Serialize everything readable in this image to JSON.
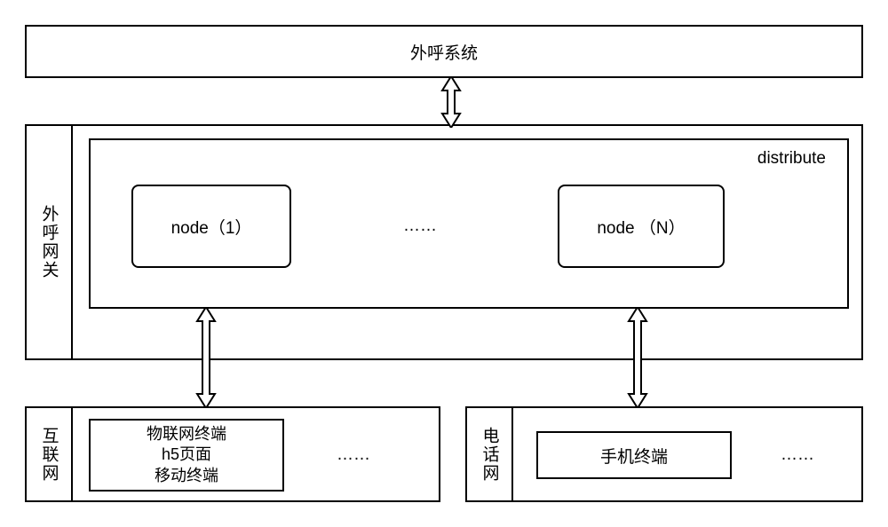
{
  "top": {
    "label": "外呼系统"
  },
  "gateway": {
    "side_label": "外呼网关",
    "distribute_label": "distribute",
    "node_left": "node（1）",
    "node_right": "node （N）",
    "ellipsis": "……"
  },
  "internet": {
    "side_label": "互联网",
    "terminal_line1": "物联网终端",
    "terminal_line2": "h5页面",
    "terminal_line3": "移动终端",
    "ellipsis": "……"
  },
  "telephone": {
    "side_label": "电话网",
    "terminal": "手机终端",
    "ellipsis": "……"
  }
}
